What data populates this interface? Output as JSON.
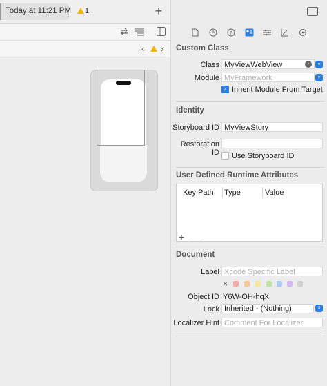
{
  "toolbar": {
    "status_text": "Today at 11:21 PM",
    "warning_count": "1",
    "add_label": "+"
  },
  "editor": {
    "icons": [
      "swap-icon",
      "lines-icon",
      "split-editor-icon"
    ]
  },
  "jumpbar": {
    "back": "‹",
    "forward": "›"
  },
  "inspector": {
    "tabs": [
      "file-icon",
      "history-icon",
      "help-icon",
      "identity-icon",
      "attributes-icon",
      "size-icon",
      "connections-icon"
    ],
    "custom_class": {
      "title": "Custom Class",
      "class_label": "Class",
      "class_value": "MyViewWebView",
      "module_label": "Module",
      "module_placeholder": "MyFramework",
      "inherit_label": "Inherit Module From Target"
    },
    "identity": {
      "title": "Identity",
      "storyboard_id_label": "Storyboard ID",
      "storyboard_id_value": "MyViewStory",
      "restoration_id_label": "Restoration ID",
      "restoration_id_value": "",
      "use_storyboard_id_label": "Use Storyboard ID"
    },
    "runtime_attributes": {
      "title": "User Defined Runtime Attributes",
      "columns": [
        "Key Path",
        "Type",
        "Value"
      ],
      "add_label": "+",
      "remove_label": "—"
    },
    "document": {
      "title": "Document",
      "label_label": "Label",
      "label_placeholder": "Xcode Specific Label",
      "swatch_clear": "×",
      "swatch_colors": [
        "#f1a7a6",
        "#f6c79b",
        "#f5e49b",
        "#bfe3a4",
        "#a9c9f4",
        "#d6b6ef",
        "#cfcfcf"
      ],
      "object_id_label": "Object ID",
      "object_id_value": "Y6W-OH-hqX",
      "lock_label": "Lock",
      "lock_value": "Inherited - (Nothing)",
      "localizer_label": "Localizer Hint",
      "localizer_placeholder": "Comment For Localizer"
    }
  }
}
